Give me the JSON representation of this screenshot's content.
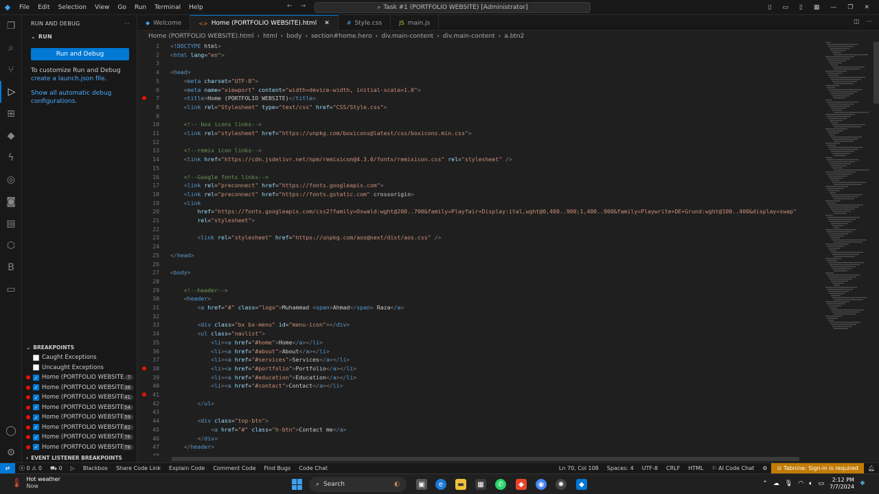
{
  "titlebar": {
    "menus": [
      "File",
      "Edit",
      "Selection",
      "View",
      "Go",
      "Run",
      "Terminal",
      "Help"
    ],
    "command_center": "Task #1 (PORTFOLIO WEBSITE) [Administrator]"
  },
  "sidebar": {
    "title": "RUN AND DEBUG",
    "section": "RUN",
    "run_button": "Run and Debug",
    "customize_prefix": "To customize Run and Debug ",
    "customize_link": "create a launch.json file",
    "customize_suffix": ".",
    "show_all": "Show all automatic debug configurations.",
    "breakpoints_title": "BREAKPOINTS",
    "caught": "Caught Exceptions",
    "uncaught": "Uncaught Exceptions",
    "breakpoints": [
      {
        "file": "Home (PORTFOLIO WEBSITE...",
        "line": "7"
      },
      {
        "file": "Home (PORTFOLIO WEBSITE...",
        "line": "38"
      },
      {
        "file": "Home (PORTFOLIO WEBSITE...",
        "line": "41"
      },
      {
        "file": "Home (PORTFOLIO WEBSITE...",
        "line": "54"
      },
      {
        "file": "Home (PORTFOLIO WEBSITE...",
        "line": "59"
      },
      {
        "file": "Home (PORTFOLIO WEBSITE...",
        "line": "62"
      },
      {
        "file": "Home (PORTFOLIO WEBSITE...",
        "line": "76"
      },
      {
        "file": "Home (PORTFOLIO WEBSITE...",
        "line": "78"
      }
    ],
    "event_listener": "EVENT LISTENER BREAKPOINTS"
  },
  "tabs": [
    {
      "label": "Welcome",
      "icon": "vscode-icon",
      "active": false
    },
    {
      "label": "Home (PORTFOLIO WEBSITE).html",
      "icon": "html-icon",
      "active": true
    },
    {
      "label": "Style.css",
      "icon": "css-icon",
      "active": false
    },
    {
      "label": "main.js",
      "icon": "js-icon",
      "active": false
    }
  ],
  "breadcrumb": [
    "Home (PORTFOLIO WEBSITE).html",
    "html",
    "body",
    "section#home.hero",
    "div.main-content",
    "div.main-content",
    "a.btn2"
  ],
  "code": {
    "breakpoint_lines": [
      7,
      38,
      41
    ],
    "lines": [
      "<!DOCTYPE html>",
      "<html lang=\"en\">",
      "",
      "<head>",
      "    <meta charset=\"UTF-8\">",
      "    <meta name=\"viewport\" content=\"width=device-width, initial-scale=1.0\">",
      "    <title>Home (PORTFOLIO WEBSITE)</title>",
      "    <link rel=\"Stylesheet\" type=\"text/css\" href=\"CSS/Style.css\">",
      "",
      "    <!-- box icons links-->",
      "    <link rel=\"stylesheet\" href=\"https://unpkg.com/boxicons@latest/css/boxicons.min.css\">",
      "",
      "    <!--remix icon links-->",
      "    <link href=\"https://cdn.jsdelivr.net/npm/remixicon@4.3.0/fonts/remixicon.css\" rel=\"stylesheet\" />",
      "",
      "    <!--Google fonts links-->",
      "    <link rel=\"preconnect\" href=\"https://fonts.googleapis.com\">",
      "    <link rel=\"preconnect\" href=\"https://fonts.gstatic.com\" crossorigin>",
      "    <link",
      "        href=\"https://fonts.googleapis.com/css2?family=Oswald:wght@200..700&family=Playfair+Display:ital,wght@0,400..900;1,400..900&family=Playwrite+DE+Grund:wght@100..400&display=swap\"",
      "        rel=\"stylesheet\">",
      "",
      "        <link rel=\"stylesheet\" href=\"https://unpkg.com/aos@next/dist/aos.css\" />",
      "",
      "</head>",
      "",
      "<body>",
      "",
      "    <!--header-->",
      "    <header>",
      "        <a href=\"#\" class=\"logo\">Muhammad <span>Ahmad</span> Raza</a>",
      "",
      "        <div class=\"bx bx-menu\" id=\"menu-icon\"></div>",
      "        <ul class=\"navlist\">",
      "            <li><a href=\"#home\">Home</a></li>",
      "            <li><a href=\"#about\">About</a></li>",
      "            <li><a href=\"#services\">Services</a></li>",
      "            <li><a href=\"#portfolio\">Portfolio</a></li>",
      "            <li><a href=\"#education\">Education</a></li>",
      "            <li><a href=\"#contact\">Contact</a></li>",
      "",
      "        </ul>",
      "",
      "        <div class=\"top-btn\">",
      "            <a href=\"#\" class=\"h-btn\">Contact me</a>",
      "        </div>",
      "    </header>",
      ""
    ]
  },
  "statusbar": {
    "problems": "0 ⚠ 0",
    "ports": "0",
    "items": [
      "Blackbox",
      "Share Code Link",
      "Explain Code",
      "Comment Code",
      "Find Bugs",
      "Code Chat"
    ],
    "position": "Ln 70, Col 108",
    "spaces": "Spaces: 4",
    "encoding": "UTF-8",
    "eol": "CRLF",
    "language": "HTML",
    "ai_chat": "AI Code Chat",
    "tabnine": "Tabnine: Sign-in is required"
  },
  "taskbar": {
    "weather_title": "Hot weather",
    "weather_sub": "Now",
    "search": "Search",
    "time": "2:12 PM",
    "date": "7/7/2024"
  },
  "colors": {
    "accent": "#0078d4",
    "breakpoint": "#e51400",
    "tabnine": "#c27b06"
  }
}
